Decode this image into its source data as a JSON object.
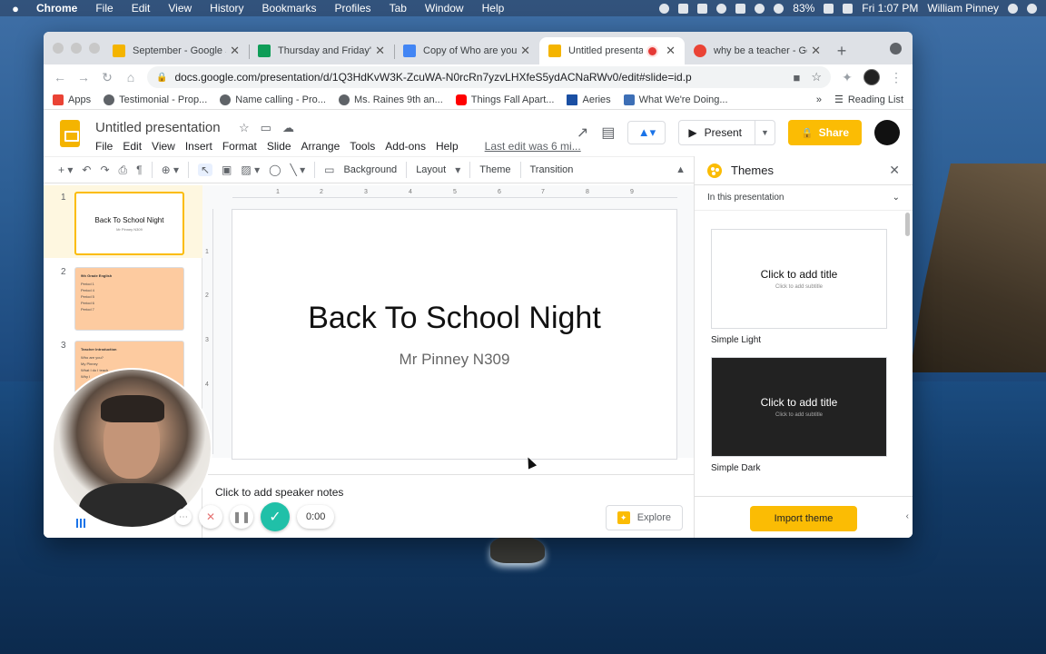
{
  "menubar": {
    "app": "Chrome",
    "items": [
      "File",
      "Edit",
      "View",
      "History",
      "Bookmarks",
      "Profiles",
      "Tab",
      "Window",
      "Help"
    ],
    "battery": "83%",
    "clock": "Fri 1:07 PM",
    "user": "William Pinney"
  },
  "browser": {
    "tabs": [
      {
        "title": "September - Google Sl",
        "color": "#f4b400"
      },
      {
        "title": "Thursday and Friday's",
        "color": "#0f9d58"
      },
      {
        "title": "Copy of Who are you -",
        "color": "#4285f4"
      },
      {
        "title": "Untitled presentatio",
        "color": "#f4b400"
      },
      {
        "title": "why be a teacher - Go",
        "color": "#ea4335"
      }
    ],
    "url": "docs.google.com/presentation/d/1Q3HdKvW3K-ZcuWA-N0rcRn7yzvLHXfeS5ydACNaRWv0/edit#slide=id.p",
    "bookmarks": [
      {
        "label": "Apps",
        "color": "#ea4335"
      },
      {
        "label": "Testimonial - Prop...",
        "color": "#5f6368"
      },
      {
        "label": "Name calling - Pro...",
        "color": "#5f6368"
      },
      {
        "label": "Ms. Raines 9th an...",
        "color": "#5f6368"
      },
      {
        "label": "Things Fall Apart...",
        "color": "#ff0000"
      },
      {
        "label": "Aeries",
        "color": "#1a4fa3"
      },
      {
        "label": "What We're Doing...",
        "color": "#3d6fb6"
      }
    ],
    "reading_list": "Reading List"
  },
  "slides": {
    "doc_title": "Untitled presentation",
    "menu": [
      "File",
      "Edit",
      "View",
      "Insert",
      "Format",
      "Slide",
      "Arrange",
      "Tools",
      "Add-ons",
      "Help"
    ],
    "last_edit": "Last edit was 6 mi...",
    "present": "Present",
    "share": "Share",
    "toolbar": {
      "background": "Background",
      "layout": "Layout",
      "theme": "Theme",
      "transition": "Transition"
    },
    "filmstrip": [
      {
        "num": "1",
        "title": "Back To School Night",
        "subtitle": "Mr Pinney N309"
      },
      {
        "num": "2",
        "title": "9th Grade English",
        "lines": [
          "Period 1",
          "Period 4",
          "Period 5",
          "Period 6",
          "Period 7"
        ]
      },
      {
        "num": "3",
        "title": "Teacher Introduction",
        "lines": [
          "Who are you?",
          "My Pinney",
          "What I do I teach",
          "Why I"
        ]
      }
    ],
    "slide": {
      "title": "Back To School Night",
      "subtitle": "Mr Pinney N309"
    },
    "notes_placeholder": "Click to add speaker notes",
    "explore": "Explore",
    "ruler_h": [
      "1",
      "2",
      "3",
      "4",
      "5",
      "6",
      "7",
      "8",
      "9"
    ],
    "ruler_v": [
      "1",
      "2",
      "3",
      "4"
    ]
  },
  "themes": {
    "title": "Themes",
    "scope": "In this presentation",
    "cards": [
      {
        "name": "Simple Light",
        "title": "Click to add title",
        "subtitle": "Click to add subtitle"
      },
      {
        "name": "Simple Dark",
        "title": "Click to add title",
        "subtitle": "Click to add subtitle"
      }
    ],
    "import": "Import theme"
  },
  "recorder": {
    "timer": "0:00"
  }
}
